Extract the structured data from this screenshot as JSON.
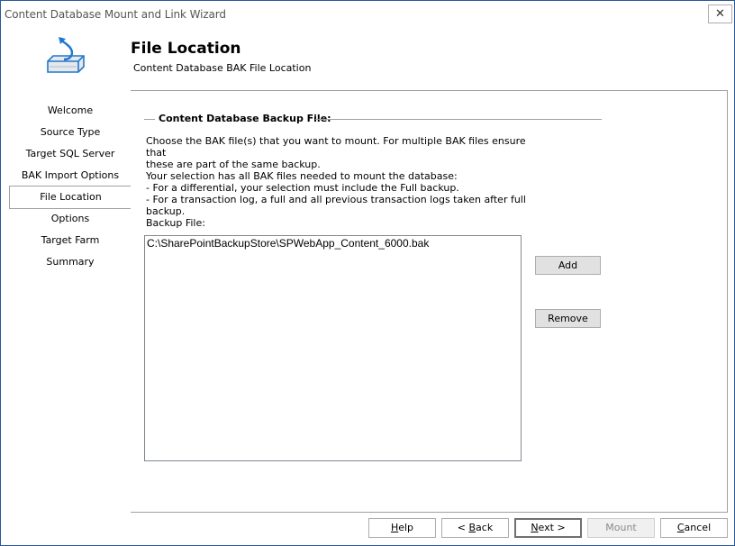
{
  "window": {
    "title": "Content Database Mount and Link Wizard",
    "close_label": "✕"
  },
  "header": {
    "icon": "database-mount-icon",
    "title": "File Location",
    "subtitle": "Content Database BAK File Location"
  },
  "nav": {
    "items": [
      {
        "label": "Welcome",
        "active": false
      },
      {
        "label": "Source Type",
        "active": false
      },
      {
        "label": "Target SQL Server",
        "active": false
      },
      {
        "label": "BAK Import Options",
        "active": false
      },
      {
        "label": "File Location",
        "active": true
      },
      {
        "label": "Options",
        "active": false
      },
      {
        "label": "Target Farm",
        "active": false
      },
      {
        "label": "Summary",
        "active": false
      }
    ]
  },
  "main": {
    "group_title": "Content Database Backup File:",
    "description": "Choose the BAK file(s) that you want to mount. For multiple BAK files ensure that\nthese are part of the same backup.\nYour selection has all BAK files needed to mount the database:\n - For a differential, your selection must include the Full backup.\n - For a transaction log, a full and all previous transaction logs taken after full\nbackup.",
    "backup_file_label": "Backup File:",
    "files": [
      "C:\\SharePointBackupStore\\SPWebApp_Content_6000.bak"
    ],
    "add_label": "Add",
    "remove_label": "Remove"
  },
  "footer": {
    "help": {
      "mnemonic": "H",
      "rest": "elp"
    },
    "back": {
      "prefix": "< ",
      "mnemonic": "B",
      "rest": "ack"
    },
    "next": {
      "mnemonic": "N",
      "rest": "ext >"
    },
    "mount": {
      "label": "Mount",
      "disabled": true
    },
    "cancel": {
      "mnemonic": "C",
      "rest": "ancel"
    }
  },
  "colors": {
    "window_border": "#2b579a",
    "icon_blue": "#1e78d2"
  }
}
